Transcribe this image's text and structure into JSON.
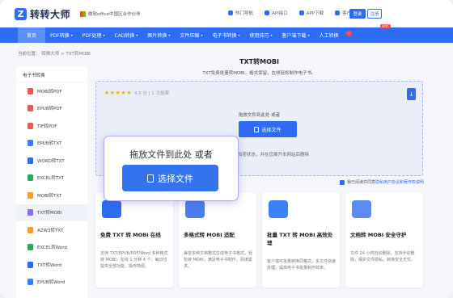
{
  "header": {
    "logo": "转转大师",
    "partner": "微软office中国区合作伙伴",
    "links": [
      "热门导航",
      "API接口",
      "APP下载",
      "客户端"
    ],
    "login": "登录",
    "register": "注册"
  },
  "nav": {
    "items": [
      {
        "label": "首页",
        "caret": ""
      },
      {
        "label": "PDF转换",
        "caret": "▾"
      },
      {
        "label": "PDF处理",
        "caret": "▾"
      },
      {
        "label": "CAD转换",
        "caret": "▾"
      },
      {
        "label": "图片转换",
        "caret": "▾"
      },
      {
        "label": "文件压缩",
        "caret": "▾"
      },
      {
        "label": "电子书转换",
        "caret": "▾"
      },
      {
        "label": "使用技巧",
        "caret": "▾"
      },
      {
        "label": "客户端下载",
        "caret": "▾"
      },
      {
        "label": "人工转换",
        "caret": ""
      }
    ],
    "hot_badge": "HOT"
  },
  "breadcrumb": "当前位置： 转换大师 > TXT转MOBI",
  "sidebar": {
    "heading": "电子书转换",
    "items": [
      {
        "label": "MOBI转PDF",
        "color": "#e25b5b"
      },
      {
        "label": "EPUB转PDF",
        "color": "#e25b5b"
      },
      {
        "label": "TIF转PDF",
        "color": "#e25b5b"
      },
      {
        "label": "EPUB转TXT",
        "color": "#3b82f6"
      },
      {
        "label": "WORD转TXT",
        "color": "#2f6cf6"
      },
      {
        "label": "EXCEL转TXT",
        "color": "#2fa55b"
      },
      {
        "label": "MOBI转TXT",
        "color": "#f0a030"
      },
      {
        "label": "TXT转MOBI",
        "color": "#8a6cf0"
      },
      {
        "label": "AZW3转TXT",
        "color": "#f0a030"
      },
      {
        "label": "EXCEL转Word",
        "color": "#2fa55b"
      },
      {
        "label": "TXT转Word",
        "color": "#2f6cf6"
      },
      {
        "label": "EPUB转Word",
        "color": "#3b82f6"
      }
    ]
  },
  "main": {
    "title": "TXT转MOBI",
    "subtitle": "TXT免费批量转MOBI，格式保留，在线轻松制作电子书。",
    "rating": "4.9 分 | 1 次投票",
    "drop_text": "拖放文件到此处 或者",
    "select_button": "选择文件",
    "drop_note": "所有文件均为加密状态，并在您离开本网站后删除",
    "agree_prefix": "我已阅读并同意",
    "agree_link": "隐私用户协议和著作权说明"
  },
  "cards": [
    {
      "title": "免费 TXT 转 MOBI 在线",
      "desc": "支持 TXT/EPUB/PDF/Word 多种格式转 MOBI，在线 1 分钟 4 个，每日也提供全部功能，操作简便。",
      "color": "#2f6cf6"
    },
    {
      "title": "多格式转 MOBI 适配",
      "desc": "兼容多种文档格式生成电子书格式，轻松转 MOBI，满足电子书制作、阅读需求。",
      "color": "#4a7df0"
    },
    {
      "title": "批量 TXT 转 MOBI 高效处理",
      "desc": "客户端可批量转换同格式，多文件快速处理，提高电子书批量制作效率。",
      "color": "#3b82f6"
    },
    {
      "title": "文档转 MOBI 安全守护",
      "desc": "文件 24 小时自动删除，支持手动删除，保护文件隐私，转换安全无忧。",
      "color": "#5a8cf5"
    }
  ],
  "popup": {
    "text": "拖放文件到此处 或者",
    "button": "选择文件"
  }
}
